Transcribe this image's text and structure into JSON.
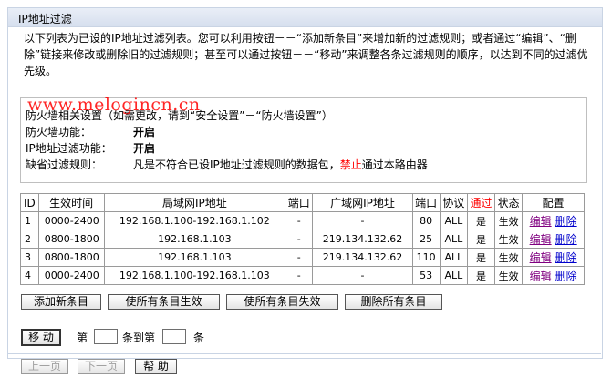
{
  "window_title": "IP地址过滤",
  "intro_text": "以下列表为已设的IP地址过滤列表。您可以利用按钮－－“添加新条目”来增加新的过滤规则；或者通过“编辑”、“删除”链接来修改或删除旧的过滤规则；甚至可以通过按钮－－“移动”来调整各条过滤规则的顺序，以达到不同的过滤优先级。",
  "watermark": "www.melogincn.cn",
  "status": {
    "header": "防火墙相关设置（如需更改，请到“安全设置”－“防火墙设置”）",
    "firewall_label": "防火墙功能：",
    "firewall_value": "开启",
    "ipfilter_label": "IP地址过滤功能：",
    "ipfilter_value": "开启",
    "default_label": "缺省过滤规则：",
    "default_pre": "凡是不符合已设IP地址过滤规则的数据包，",
    "default_red": "禁止",
    "default_post": "通过本路由器"
  },
  "table": {
    "headers": [
      "ID",
      "生效时间",
      "局域网IP地址",
      "端口",
      "广域网IP地址",
      "端口",
      "协议",
      "通过",
      "状态",
      "配置"
    ],
    "edit_label": "编辑",
    "delete_label": "删除",
    "rows": [
      {
        "id": "1",
        "time": "0000-2400",
        "lan_ip": "192.168.1.100-192.168.1.102",
        "lan_port": "-",
        "wan_ip": "-",
        "wan_port": "80",
        "protocol": "ALL",
        "pass": "是",
        "status": "生效"
      },
      {
        "id": "2",
        "time": "0800-1800",
        "lan_ip": "192.168.1.103",
        "lan_port": "-",
        "wan_ip": "219.134.132.62",
        "wan_port": "25",
        "protocol": "ALL",
        "pass": "是",
        "status": "生效"
      },
      {
        "id": "3",
        "time": "0800-1800",
        "lan_ip": "192.168.1.103",
        "lan_port": "-",
        "wan_ip": "219.134.132.62",
        "wan_port": "110",
        "protocol": "ALL",
        "pass": "是",
        "status": "生效"
      },
      {
        "id": "4",
        "time": "0000-2400",
        "lan_ip": "192.168.1.100-192.168.1.103",
        "lan_port": "-",
        "wan_ip": "-",
        "wan_port": "53",
        "protocol": "ALL",
        "pass": "是",
        "status": "生效"
      }
    ]
  },
  "buttons": {
    "add": "添加新条目",
    "enable_all": "使所有条目生效",
    "disable_all": "使所有条目失效",
    "delete_all": "删除所有条目",
    "move": "移 动",
    "prev": "上一页",
    "next": "下一页",
    "help": "帮 助"
  },
  "move_row": {
    "pre": "第",
    "mid": "条到第",
    "post": "条"
  },
  "colors": {
    "red": "#ff0000",
    "link": "#0000cc",
    "link_visited": "#800080",
    "border": "#c9d4e4"
  }
}
